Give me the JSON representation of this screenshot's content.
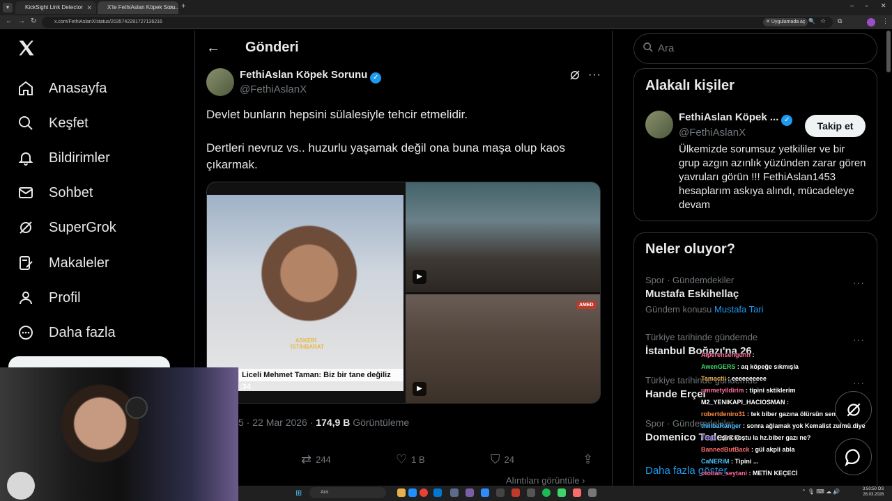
{
  "browser": {
    "tabs": [
      {
        "title": "KickSight Link Detector"
      },
      {
        "title": "X'te FethiAslan Köpek Soru..."
      }
    ],
    "url": "x.com/FethiAslanX/status/2035742281727136216",
    "open_in_app": "Uygulamada aç"
  },
  "sidebar": {
    "items": [
      {
        "label": "Anasayfa",
        "icon": "home-icon"
      },
      {
        "label": "Keşfet",
        "icon": "search-icon"
      },
      {
        "label": "Bildirimler",
        "icon": "bell-icon"
      },
      {
        "label": "Sohbet",
        "icon": "mail-icon"
      },
      {
        "label": "SuperGrok",
        "icon": "grok-icon"
      },
      {
        "label": "Makaleler",
        "icon": "article-icon"
      },
      {
        "label": "Profil",
        "icon": "person-icon"
      },
      {
        "label": "Daha fazla",
        "icon": "more-icon"
      }
    ]
  },
  "post": {
    "header_title": "Gönderi",
    "author_name": "FethiAslan Köpek Sorunu",
    "author_handle": "@FethiAslanX",
    "text1": "Devlet bunların hepsini sülalesiyle tehcir etmelidir.",
    "text2": "Dertleri nevruz vs.. huzurlu yaşamak değil ona buna maşa olup kaos çıkarmak.",
    "video_caption": "Liceli Mehmet Taman: Biz bir tane değiliz",
    "video_watermark": "ASKERİ İSTİHBARAT",
    "video_time": ":34",
    "badge_amed": "AMED",
    "date_text": "5 · 22 Mar 2026 · ",
    "views": "174,9 B",
    "views_label": " Görüntüleme",
    "reposts": "244",
    "likes": "1 B",
    "bookmarks": "24",
    "quotes_link": "Alıntıları görüntüle"
  },
  "right": {
    "search_placeholder": "Ara",
    "related_title": "Alakalı kişiler",
    "related_name": "FethiAslan Köpek ...",
    "related_handle": "@FethiAslanX",
    "follow_label": "Takip et",
    "related_bio": "Ülkemizde sorumsuz yetkililer ve bir grup azgın azınlık yüzünden zarar gören yavruları görün !!! FethiAslan1453 hesaplarım askıya alındı, mücadeleye devam",
    "trends_title": "Neler oluyor?",
    "trends": [
      {
        "context": "Spor · Gündemdekiler",
        "name": "Mustafa Eskihellaç",
        "extra_prefix": "Gündem konusu",
        "extra_link": "Mustafa Tari"
      },
      {
        "context": "Türkiye tarihinde gündemde",
        "name": "İstanbul Boğazı'na 26"
      },
      {
        "context": "Türkiye tarihinde gündemde",
        "name": "Hande Erçel"
      },
      {
        "context": "Spor · Gündemdekiler",
        "name": "Domenico Tedesco"
      }
    ],
    "show_more": "Daha fazla göster"
  },
  "chat": [
    {
      "user": "Alperensengunn",
      "msg": "",
      "color": "#ff6b9d"
    },
    {
      "user": "AwenGERS",
      "msg": "aq köpeğe sıkmışla",
      "color": "#3fd46a"
    },
    {
      "user": "Tamactii",
      "msg": "eeeeeeeeee",
      "color": "#e8b04c"
    },
    {
      "user": "ummetyildirim",
      "msg": "tipini sktiklerim",
      "color": "#ff6b9d"
    },
    {
      "user": "M2_YENIKAPI_HACIOSMAN",
      "msg": "",
      "color": "#ffffff"
    },
    {
      "user": "robertdeniro31",
      "msg": "tek biber gazına ölürsün sen",
      "color": "#ff8c42"
    },
    {
      "user": "thillbaRanger",
      "msg": "sonra ağlamak yok Kemalist zulmü diye",
      "color": "#4cc3ff"
    },
    {
      "user": "Teqir",
      "msg": "şirk koştu la hz.biber gazı ne?",
      "color": "#b48cff"
    },
    {
      "user": "BannedButBack",
      "msg": "gül akpli abla",
      "color": "#ff6b6b"
    },
    {
      "user": "CaNERiM",
      "msg": "Tipini ...",
      "color": "#4cc3ff"
    },
    {
      "user": "otoban_seytani",
      "msg": "METİN KEÇECİ",
      "color": "#ff6b9d"
    }
  ],
  "taskbar": {
    "search_placeholder": "Ara",
    "time": "3:50:50 ÖS",
    "date": "26.03.2026"
  },
  "colors": {
    "accent": "#1d9bf0",
    "background": "#000000",
    "border": "#2f3336",
    "muted": "#71767b"
  }
}
